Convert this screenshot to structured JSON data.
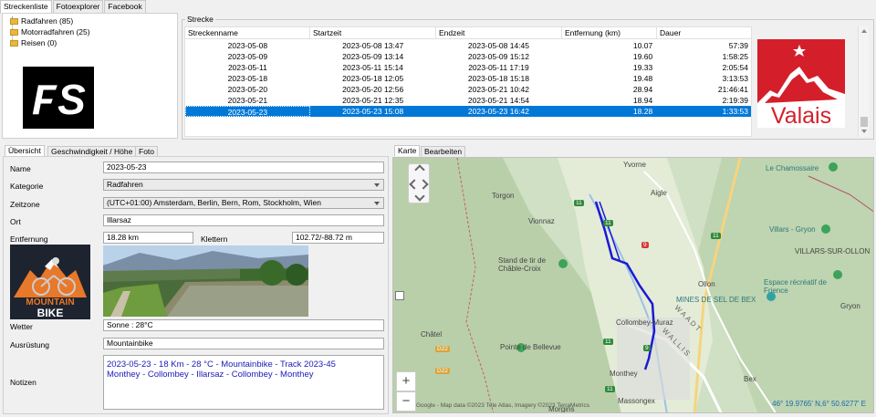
{
  "top_tabs": [
    "Streckenliste",
    "Fotoexplorer",
    "Facebook"
  ],
  "tree": [
    {
      "label": "Radfahren (85)"
    },
    {
      "label": "Motorradfahren (25)"
    },
    {
      "label": "Reisen (0)"
    }
  ],
  "logo_fs": "FS",
  "strecke_group": "Strecke",
  "grid": {
    "columns": [
      "Streckenname",
      "Startzeit",
      "Endzeit",
      "Entfernung (km)",
      "Dauer"
    ],
    "rows": [
      [
        "2023-05-08",
        "2023-05-08 13:47",
        "2023-05-08 14:45",
        "10.07",
        "57:39"
      ],
      [
        "2023-05-09",
        "2023-05-09 13:14",
        "2023-05-09 15:12",
        "19.60",
        "1:58:25"
      ],
      [
        "2023-05-11",
        "2023-05-11 15:14",
        "2023-05-11 17:19",
        "19.33",
        "2:05:54"
      ],
      [
        "2023-05-18",
        "2023-05-18 12:05",
        "2023-05-18 15:18",
        "19.48",
        "3:13:53"
      ],
      [
        "2023-05-20",
        "2023-05-20 12:56",
        "2023-05-21 10:42",
        "28.94",
        "21:46:41"
      ],
      [
        "2023-05-21",
        "2023-05-21 12:35",
        "2023-05-21 14:54",
        "18.94",
        "2:19:39"
      ],
      [
        "2023-05-23",
        "2023-05-23 15:08",
        "2023-05-23 16:42",
        "18.28",
        "1:33:53"
      ]
    ],
    "selected_row": 6
  },
  "valais_logo": "Valais",
  "detail_tabs": [
    "Übersicht",
    "Geschwindigkeit / Höhe",
    "Foto"
  ],
  "form": {
    "name_label": "Name",
    "name_value": "2023-05-23",
    "kategorie_label": "Kategorie",
    "kategorie_value": "Radfahren",
    "zeitzone_label": "Zeitzone",
    "zeitzone_value": "(UTC+01:00) Amsterdam, Berlin, Bern, Rom, Stockholm, Wien",
    "ort_label": "Ort",
    "ort_value": "Illarsaz",
    "entfernung_label": "Entfernung",
    "entfernung_value": "18.28 km",
    "klettern_label": "Klettern",
    "klettern_value": "102.72/-88.72 m",
    "wetter_label": "Wetter",
    "wetter_value": "Sonne : 28°C",
    "ausruestung_label": "Ausrüstung",
    "ausruestung_value": "Mountainbike",
    "notizen_label": "Notizen",
    "notizen_line1": "2023-05-23  - 18 Km - 28 °C - Mountainbike  - Track 2023-45",
    "notizen_line2": "Monthey - Collombey - Illarsaz - Collombey - Monthey"
  },
  "mtb_logo": {
    "line1": "MOUNTAIN",
    "line2": "BIKE"
  },
  "map_tabs": [
    "Karte",
    "Bearbeiten"
  ],
  "map": {
    "labels": [
      "Yvorne",
      "Aigle",
      "Torgon",
      "Vionnaz",
      "Le Chamossaire",
      "Villars - Gryon",
      "VILLARS-SUR-OLLON",
      "Stand de tir de Châble-Croix",
      "Ollon",
      "Espace récréatif de Frience",
      "MINES DE SEL DE BEX",
      "Gryon",
      "Collombey-Muraz",
      "WAADT",
      "WALLIS",
      "Châtel",
      "Pointe de Bellevue",
      "Monthey",
      "Bex",
      "Massongex",
      "Morgins"
    ],
    "road_badges": [
      "11",
      "11",
      "9",
      "11",
      "11",
      "11",
      "D22",
      "D22",
      "9"
    ],
    "attribution": "Google - Map data ©2023 Tele Atlas, Imagery ©2023 TerraMetrics",
    "coords": "46° 19.9765' N,6° 50.6277' E",
    "zoom_in": "+",
    "zoom_out": "−"
  },
  "colors": {
    "selection": "#0078d7",
    "track": "#1a1ad6",
    "valais_red": "#d41f2b",
    "notes_text": "#1a1ab8"
  }
}
